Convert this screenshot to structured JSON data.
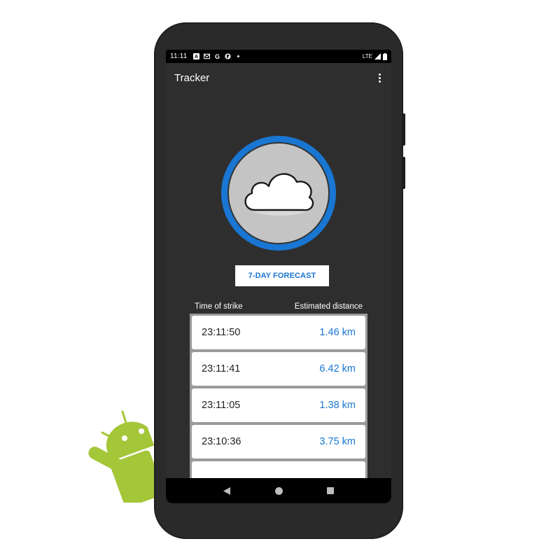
{
  "status_bar": {
    "time": "11:11",
    "left_icons": [
      "accessibility-icon",
      "gmail-icon",
      "google-icon",
      "app-icon",
      "dot-icon"
    ],
    "network": "LTE",
    "right_icons": [
      "signal-icon",
      "battery-icon"
    ]
  },
  "app_bar": {
    "title": "Tracker",
    "menu_icon": "more-vert-icon"
  },
  "weather": {
    "icon": "cloud-icon",
    "ring_color": "#1976d2"
  },
  "forecast_button": {
    "label": "7-DAY FORECAST"
  },
  "strike_table": {
    "headers": [
      "Time of strike",
      "Estimated distance"
    ],
    "rows": [
      {
        "time": "23:11:50",
        "distance": "1.46 km"
      },
      {
        "time": "23:11:41",
        "distance": "6.42 km"
      },
      {
        "time": "23:11:05",
        "distance": "1.38 km"
      },
      {
        "time": "23:10:36",
        "distance": "3.75 km"
      }
    ]
  },
  "nav_bar": {
    "buttons": [
      "back-icon",
      "home-icon",
      "recents-icon"
    ]
  },
  "colors": {
    "accent": "#1976d2",
    "screen_bg": "#2e2e2e",
    "android_green": "#a4c639"
  }
}
